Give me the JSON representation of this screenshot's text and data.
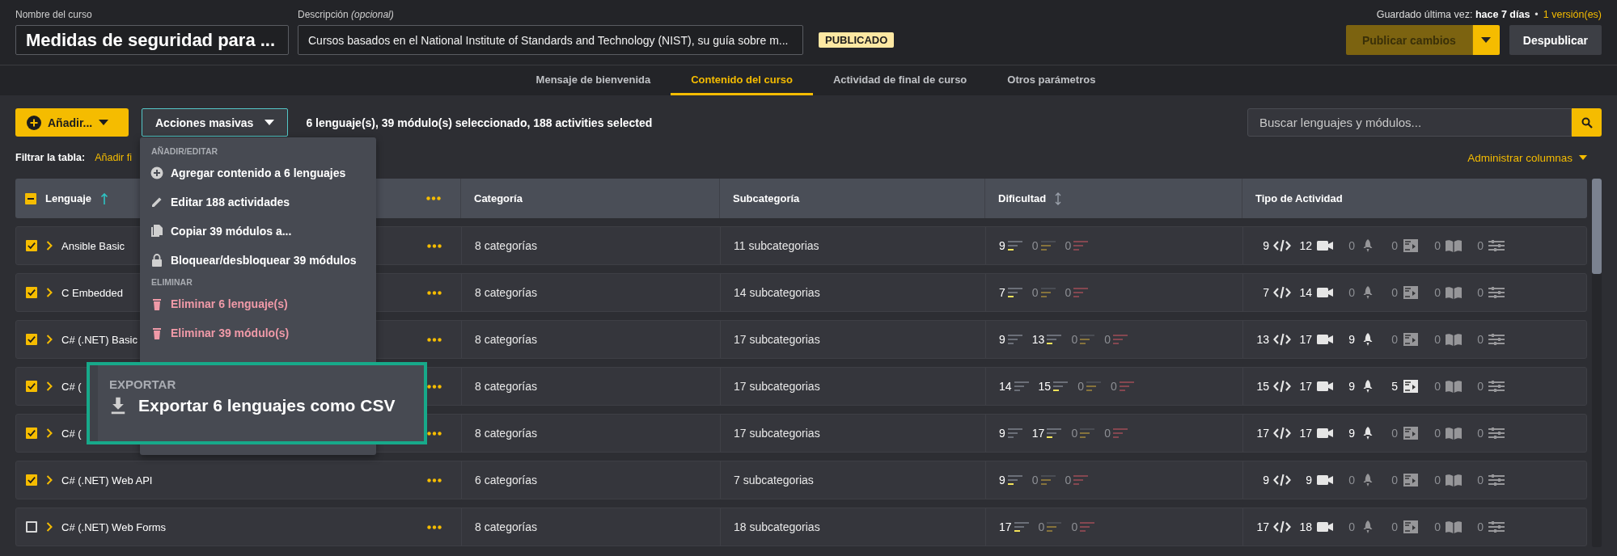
{
  "course_name": {
    "label": "Nombre del curso",
    "value": "Medidas de seguridad para ..."
  },
  "description": {
    "label": "Descripción *(opcional)*",
    "value": "Cursos basados en el National Institute of Standards and Technology (NIST), su guía sobre m..."
  },
  "status_badge": "PUBLICADO",
  "saved": {
    "label": "Guardado última vez:",
    "value": "hace 7 días",
    "separator": "•",
    "versions_link": "1 versión(es)"
  },
  "publish_button": {
    "label": "Publicar cambios",
    "disabled": true
  },
  "unpublish_button": "Despublicar",
  "tabs": [
    {
      "label": "Mensaje de bienvenida",
      "selected": false
    },
    {
      "label": "Contenido del curso",
      "selected": true
    },
    {
      "label": "Actividad de final de curso",
      "selected": false
    },
    {
      "label": "Otros parámetros",
      "selected": false
    }
  ],
  "add_button": "Añadir...",
  "bulk_actions": {
    "label": "Acciones masivas",
    "expanded": true
  },
  "selection_summary": "6 lenguaje(s), 39 módulo(s) seleccionado, 188 activities selected",
  "search": {
    "placeholder": "Buscar lenguajes y módulos..."
  },
  "filter": {
    "label": "Filtrar la tabla:",
    "link": "Añadir fi"
  },
  "manage_columns": "Administrar columnas",
  "menu": {
    "sections": [
      {
        "title": "AÑADIR/EDITAR",
        "items": [
          {
            "label": "Agregar contenido a 6 lenguajes",
            "kind": "add"
          },
          {
            "label": "Editar 188 actividades",
            "kind": "edit"
          },
          {
            "label": "Copiar 39 módulos a...",
            "kind": "copy"
          },
          {
            "label": "Bloquear/desbloquear 39 módulos",
            "kind": "lock"
          }
        ]
      },
      {
        "title": "ELIMINAR",
        "items": [
          {
            "label": "Eliminar 6 lenguaje(s)",
            "kind": "delete"
          },
          {
            "label": "Eliminar 39 módulo(s)",
            "kind": "delete"
          }
        ]
      }
    ]
  },
  "callout": {
    "title": "EXPORTAR",
    "item": "Exportar 6 lenguajes como CSV"
  },
  "table": {
    "select_all_partial": true,
    "columns": [
      "Lenguaje",
      "Categoría",
      "Subcategoría",
      "Dificultad",
      "Tipo de Actividad"
    ],
    "rows": [
      {
        "checked": true,
        "name": "Ansible Basic",
        "category": "8 categorías",
        "subcategory": "11 subcategorias",
        "difficulty": [
          {
            "count": "9",
            "kind": "easy",
            "dim": false
          },
          {
            "count": "0",
            "kind": "medium",
            "dim": true
          },
          {
            "count": "0",
            "kind": "hard",
            "dim": true
          }
        ],
        "activities": [
          {
            "count": "9",
            "kind": "code",
            "dim": false
          },
          {
            "count": "12",
            "kind": "video",
            "dim": false
          },
          {
            "count": "0",
            "kind": "rocket",
            "dim": true
          },
          {
            "count": "0",
            "kind": "slides",
            "dim": true
          },
          {
            "count": "0",
            "kind": "book",
            "dim": true
          },
          {
            "count": "0",
            "kind": "sliders",
            "dim": true
          }
        ]
      },
      {
        "checked": true,
        "name": "C Embedded",
        "category": "8 categorías",
        "subcategory": "14 subcategorias",
        "difficulty": [
          {
            "count": "7",
            "kind": "easy",
            "dim": false
          },
          {
            "count": "0",
            "kind": "medium",
            "dim": true
          },
          {
            "count": "0",
            "kind": "hard",
            "dim": true
          }
        ],
        "activities": [
          {
            "count": "7",
            "kind": "code",
            "dim": false
          },
          {
            "count": "14",
            "kind": "video",
            "dim": false
          },
          {
            "count": "0",
            "kind": "rocket",
            "dim": true
          },
          {
            "count": "0",
            "kind": "slides",
            "dim": true
          },
          {
            "count": "0",
            "kind": "book",
            "dim": true
          },
          {
            "count": "0",
            "kind": "sliders",
            "dim": true
          }
        ]
      },
      {
        "checked": true,
        "name": "C# (.NET) Basic",
        "category": "8 categorías",
        "subcategory": "17 subcategorias",
        "difficulty": [
          {
            "count": "9",
            "kind": "basic",
            "dim": false
          },
          {
            "count": "13",
            "kind": "easy",
            "dim": false
          },
          {
            "count": "0",
            "kind": "medium",
            "dim": true
          },
          {
            "count": "0",
            "kind": "hard",
            "dim": true
          }
        ],
        "activities": [
          {
            "count": "13",
            "kind": "code",
            "dim": false
          },
          {
            "count": "17",
            "kind": "video",
            "dim": false
          },
          {
            "count": "9",
            "kind": "rocket",
            "dim": false
          },
          {
            "count": "0",
            "kind": "slides",
            "dim": true
          },
          {
            "count": "0",
            "kind": "book",
            "dim": true
          },
          {
            "count": "0",
            "kind": "sliders",
            "dim": true
          }
        ]
      },
      {
        "checked": true,
        "name": "C# (",
        "category": "8 categorías",
        "subcategory": "17 subcategorias",
        "difficulty": [
          {
            "count": "14",
            "kind": "basic",
            "dim": false
          },
          {
            "count": "15",
            "kind": "easy",
            "dim": false
          },
          {
            "count": "0",
            "kind": "medium",
            "dim": true
          },
          {
            "count": "0",
            "kind": "hard",
            "dim": true
          }
        ],
        "activities": [
          {
            "count": "15",
            "kind": "code",
            "dim": false
          },
          {
            "count": "17",
            "kind": "video",
            "dim": false
          },
          {
            "count": "9",
            "kind": "rocket",
            "dim": false
          },
          {
            "count": "5",
            "kind": "slides",
            "dim": false
          },
          {
            "count": "0",
            "kind": "book",
            "dim": true
          },
          {
            "count": "0",
            "kind": "sliders",
            "dim": true
          }
        ]
      },
      {
        "checked": true,
        "name": "C# (",
        "category": "8 categorías",
        "subcategory": "17 subcategorias",
        "difficulty": [
          {
            "count": "9",
            "kind": "basic",
            "dim": false
          },
          {
            "count": "17",
            "kind": "easy",
            "dim": false
          },
          {
            "count": "0",
            "kind": "medium",
            "dim": true
          },
          {
            "count": "0",
            "kind": "hard",
            "dim": true
          }
        ],
        "activities": [
          {
            "count": "17",
            "kind": "code",
            "dim": false
          },
          {
            "count": "17",
            "kind": "video",
            "dim": false
          },
          {
            "count": "9",
            "kind": "rocket",
            "dim": false
          },
          {
            "count": "0",
            "kind": "slides",
            "dim": true
          },
          {
            "count": "0",
            "kind": "book",
            "dim": true
          },
          {
            "count": "0",
            "kind": "sliders",
            "dim": true
          }
        ]
      },
      {
        "checked": true,
        "name": "C# (.NET) Web API",
        "category": "6 categorías",
        "subcategory": "7 subcategorias",
        "difficulty": [
          {
            "count": "9",
            "kind": "easy",
            "dim": false
          },
          {
            "count": "0",
            "kind": "medium",
            "dim": true
          },
          {
            "count": "0",
            "kind": "hard",
            "dim": true
          }
        ],
        "activities": [
          {
            "count": "9",
            "kind": "code",
            "dim": false
          },
          {
            "count": "9",
            "kind": "video",
            "dim": false
          },
          {
            "count": "0",
            "kind": "rocket",
            "dim": true
          },
          {
            "count": "0",
            "kind": "slides",
            "dim": true
          },
          {
            "count": "0",
            "kind": "book",
            "dim": true
          },
          {
            "count": "0",
            "kind": "sliders",
            "dim": true
          }
        ]
      },
      {
        "checked": false,
        "name": "C# (.NET) Web Forms",
        "category": "8 categorías",
        "subcategory": "18 subcategorias",
        "difficulty": [
          {
            "count": "17",
            "kind": "easy",
            "dim": false
          },
          {
            "count": "0",
            "kind": "medium",
            "dim": true
          },
          {
            "count": "0",
            "kind": "hard",
            "dim": true
          }
        ],
        "activities": [
          {
            "count": "17",
            "kind": "code",
            "dim": false
          },
          {
            "count": "18",
            "kind": "video",
            "dim": false
          },
          {
            "count": "0",
            "kind": "rocket",
            "dim": true
          },
          {
            "count": "0",
            "kind": "slides",
            "dim": true
          },
          {
            "count": "0",
            "kind": "book",
            "dim": true
          },
          {
            "count": "0",
            "kind": "sliders",
            "dim": true
          }
        ]
      }
    ]
  }
}
